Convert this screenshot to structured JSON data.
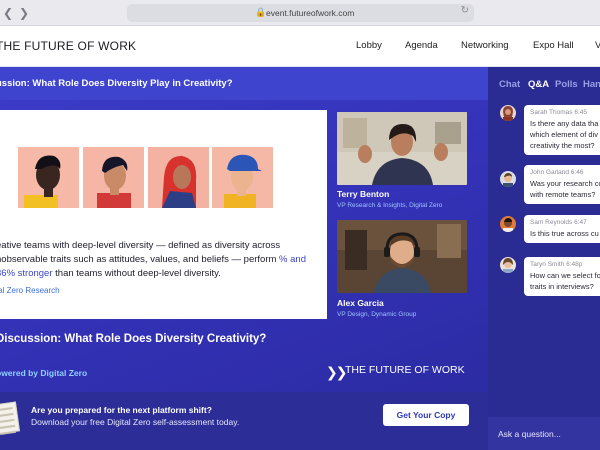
{
  "browser": {
    "url": "event.futureofwork.com"
  },
  "header": {
    "logo": "THE FUTURE OF WORK",
    "nav": [
      "Lobby",
      "Agenda",
      "Networking",
      "Expo Hall",
      "V"
    ]
  },
  "stage": {
    "title": "ussion: What Role Does Diversity Play in Creativity?",
    "slide": {
      "text_before": "eative teams with deep-level diversity — defined as diversity across nobservable traits such as attitudes, values, and beliefs — perform ",
      "highlight": "% and 36% stronger",
      "text_after": " than teams without deep-level diversity.",
      "source": "tal Zero Research"
    },
    "speakers": [
      {
        "name": "Terry Benton",
        "role": "VP Research & Insights, Digital Zero"
      },
      {
        "name": "Alex Garcia",
        "role": "VP Design, Dynamic Group"
      }
    ],
    "session_title": "Discussion: What Role Does Diversity Creativity?",
    "powered_by": "owered by Digital Zero",
    "brand": "THE FUTURE OF WORK"
  },
  "banner": {
    "heading": "Are you prepared for the next platform shift?",
    "body": "Download your free Digital Zero self-assessment today.",
    "cta": "Get Your Copy"
  },
  "chat": {
    "tabs": [
      {
        "label": "Chat",
        "active": false
      },
      {
        "label": "Q&A",
        "active": true
      },
      {
        "label": "Polls",
        "active": false
      },
      {
        "label": "Han",
        "active": false
      }
    ],
    "messages": [
      {
        "name": "Sarah Thomas",
        "time": "6:45",
        "lines": [
          "Is there any data tha",
          "which element of div",
          "creativity the most?"
        ]
      },
      {
        "name": "John Garland",
        "time": "6:46",
        "lines": [
          "Was your research co",
          "with remote teams?"
        ]
      },
      {
        "name": "Sam Reynolds",
        "time": "6:47",
        "lines": [
          "Is this true across cu"
        ]
      },
      {
        "name": "Taryn Smith",
        "time": "6:48p",
        "lines": [
          "How can we select fo",
          "traits in interviews?"
        ]
      }
    ],
    "input_placeholder": "Ask a question..."
  },
  "colors": {
    "accent": "#3f44cf",
    "panel": "#2a2b93",
    "link": "#3d6fe0"
  }
}
